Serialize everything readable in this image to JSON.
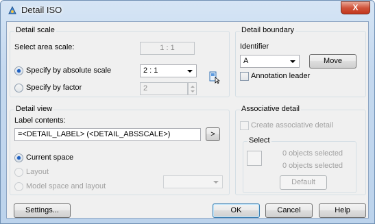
{
  "window": {
    "title": "Detail ISO",
    "close_label": "X"
  },
  "detail_scale": {
    "title": "Detail scale",
    "select_area_label": "Select area scale:",
    "area_scale_value": "1 : 1",
    "absolute_label": "Specify by absolute scale",
    "absolute_value": "2 : 1",
    "factor_label": "Specify by factor",
    "factor_value": "2"
  },
  "detail_boundary": {
    "title": "Detail boundary",
    "identifier_label": "Identifier",
    "identifier_value": "A",
    "move_label": "Move",
    "annotation_leader_label": "Annotation leader"
  },
  "detail_view": {
    "title": "Detail view",
    "label_contents_label": "Label contents:",
    "label_contents_value": "=<DETAIL_LABEL> (<DETAIL_ABSSCALE>)",
    "more_label": ">",
    "current_space_label": "Current space",
    "layout_label": "Layout",
    "model_space_label": "Model space and layout"
  },
  "associative_detail": {
    "title": "Associative detail",
    "create_label": "Create associative detail",
    "select_title": "Select",
    "objects_selected_1": "0 objects selected",
    "objects_selected_2": "0 objects selected",
    "default_label": "Default"
  },
  "footer": {
    "settings_label": "Settings...",
    "ok_label": "OK",
    "cancel_label": "Cancel",
    "help_label": "Help"
  },
  "icons": [
    "app-icon",
    "pick-scale-icon"
  ]
}
